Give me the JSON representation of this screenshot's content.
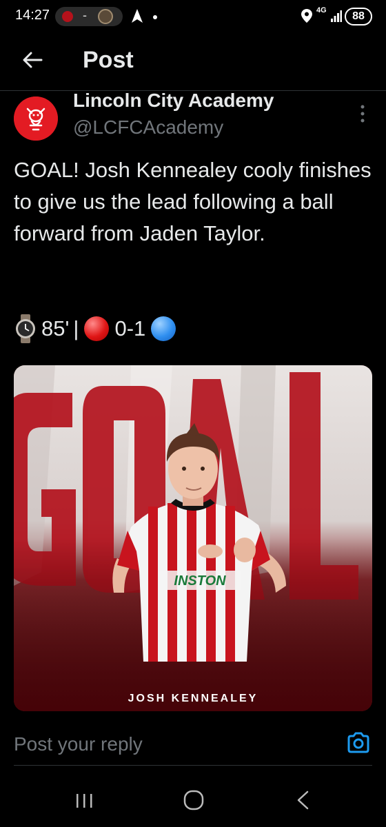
{
  "status_bar": {
    "time": "14:27",
    "network": "4G",
    "battery": "88",
    "dash": "-"
  },
  "header": {
    "title": "Post"
  },
  "post": {
    "author_name": "Lincoln City Academy",
    "author_handle": "@LCFCAcademy",
    "text": "GOAL! Josh Kennealey cooly finishes to give us the lead following a ball forward from Jaden Taylor.",
    "minute": "85'",
    "separator": "|",
    "score": "0-1",
    "media": {
      "background_word": "GOAL",
      "player_name": "JOSH KENNEALEY",
      "sponsor": "INSTON"
    }
  },
  "reply": {
    "placeholder": "Post your reply"
  },
  "colors": {
    "accent": "#1d9bf0",
    "brand_red": "#e31b23",
    "secondary_text": "#71767b"
  },
  "icons": {
    "back": "arrow-left-icon",
    "more": "more-vertical-icon",
    "camera": "camera-icon",
    "watch": "watch-icon",
    "red_circle": "red-circle-icon",
    "blue_circle": "blue-circle-icon"
  }
}
